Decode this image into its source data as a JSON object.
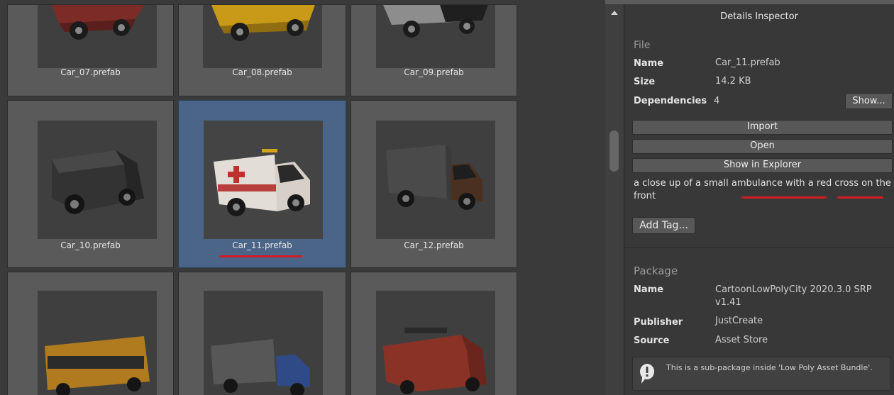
{
  "assets": {
    "tiles": [
      {
        "label": "Car_07.prefab",
        "selected": false
      },
      {
        "label": "Car_08.prefab",
        "selected": false
      },
      {
        "label": "Car_09.prefab",
        "selected": false
      },
      {
        "label": "Car_10.prefab",
        "selected": false
      },
      {
        "label": "Car_11.prefab",
        "selected": true
      },
      {
        "label": "Car_12.prefab",
        "selected": false
      },
      {
        "label": "",
        "selected": false
      },
      {
        "label": "",
        "selected": false
      },
      {
        "label": "",
        "selected": false
      }
    ]
  },
  "inspector": {
    "title": "Details Inspector",
    "file": {
      "section": "File",
      "name_label": "Name",
      "name_value": "Car_11.prefab",
      "size_label": "Size",
      "size_value": "14.2 KB",
      "deps_label": "Dependencies",
      "deps_value": "4",
      "show_button": "Show..."
    },
    "buttons": {
      "import": "Import",
      "open": "Open",
      "show_in_explorer": "Show in Explorer"
    },
    "description": "a close up of a small ambulance with a red cross on the front",
    "add_tag": "Add Tag...",
    "package": {
      "section": "Package",
      "name_label": "Name",
      "name_value": "CartoonLowPolyCity 2020.3.0 SRP v1.41",
      "publisher_label": "Publisher",
      "publisher_value": "JustCreate",
      "source_label": "Source",
      "source_value": "Asset Store"
    },
    "note": "This is a sub-package inside 'Low Poly Asset Bundle'."
  },
  "colors": {
    "selection": "#4a6587",
    "annotation_red": "#d21c22"
  }
}
